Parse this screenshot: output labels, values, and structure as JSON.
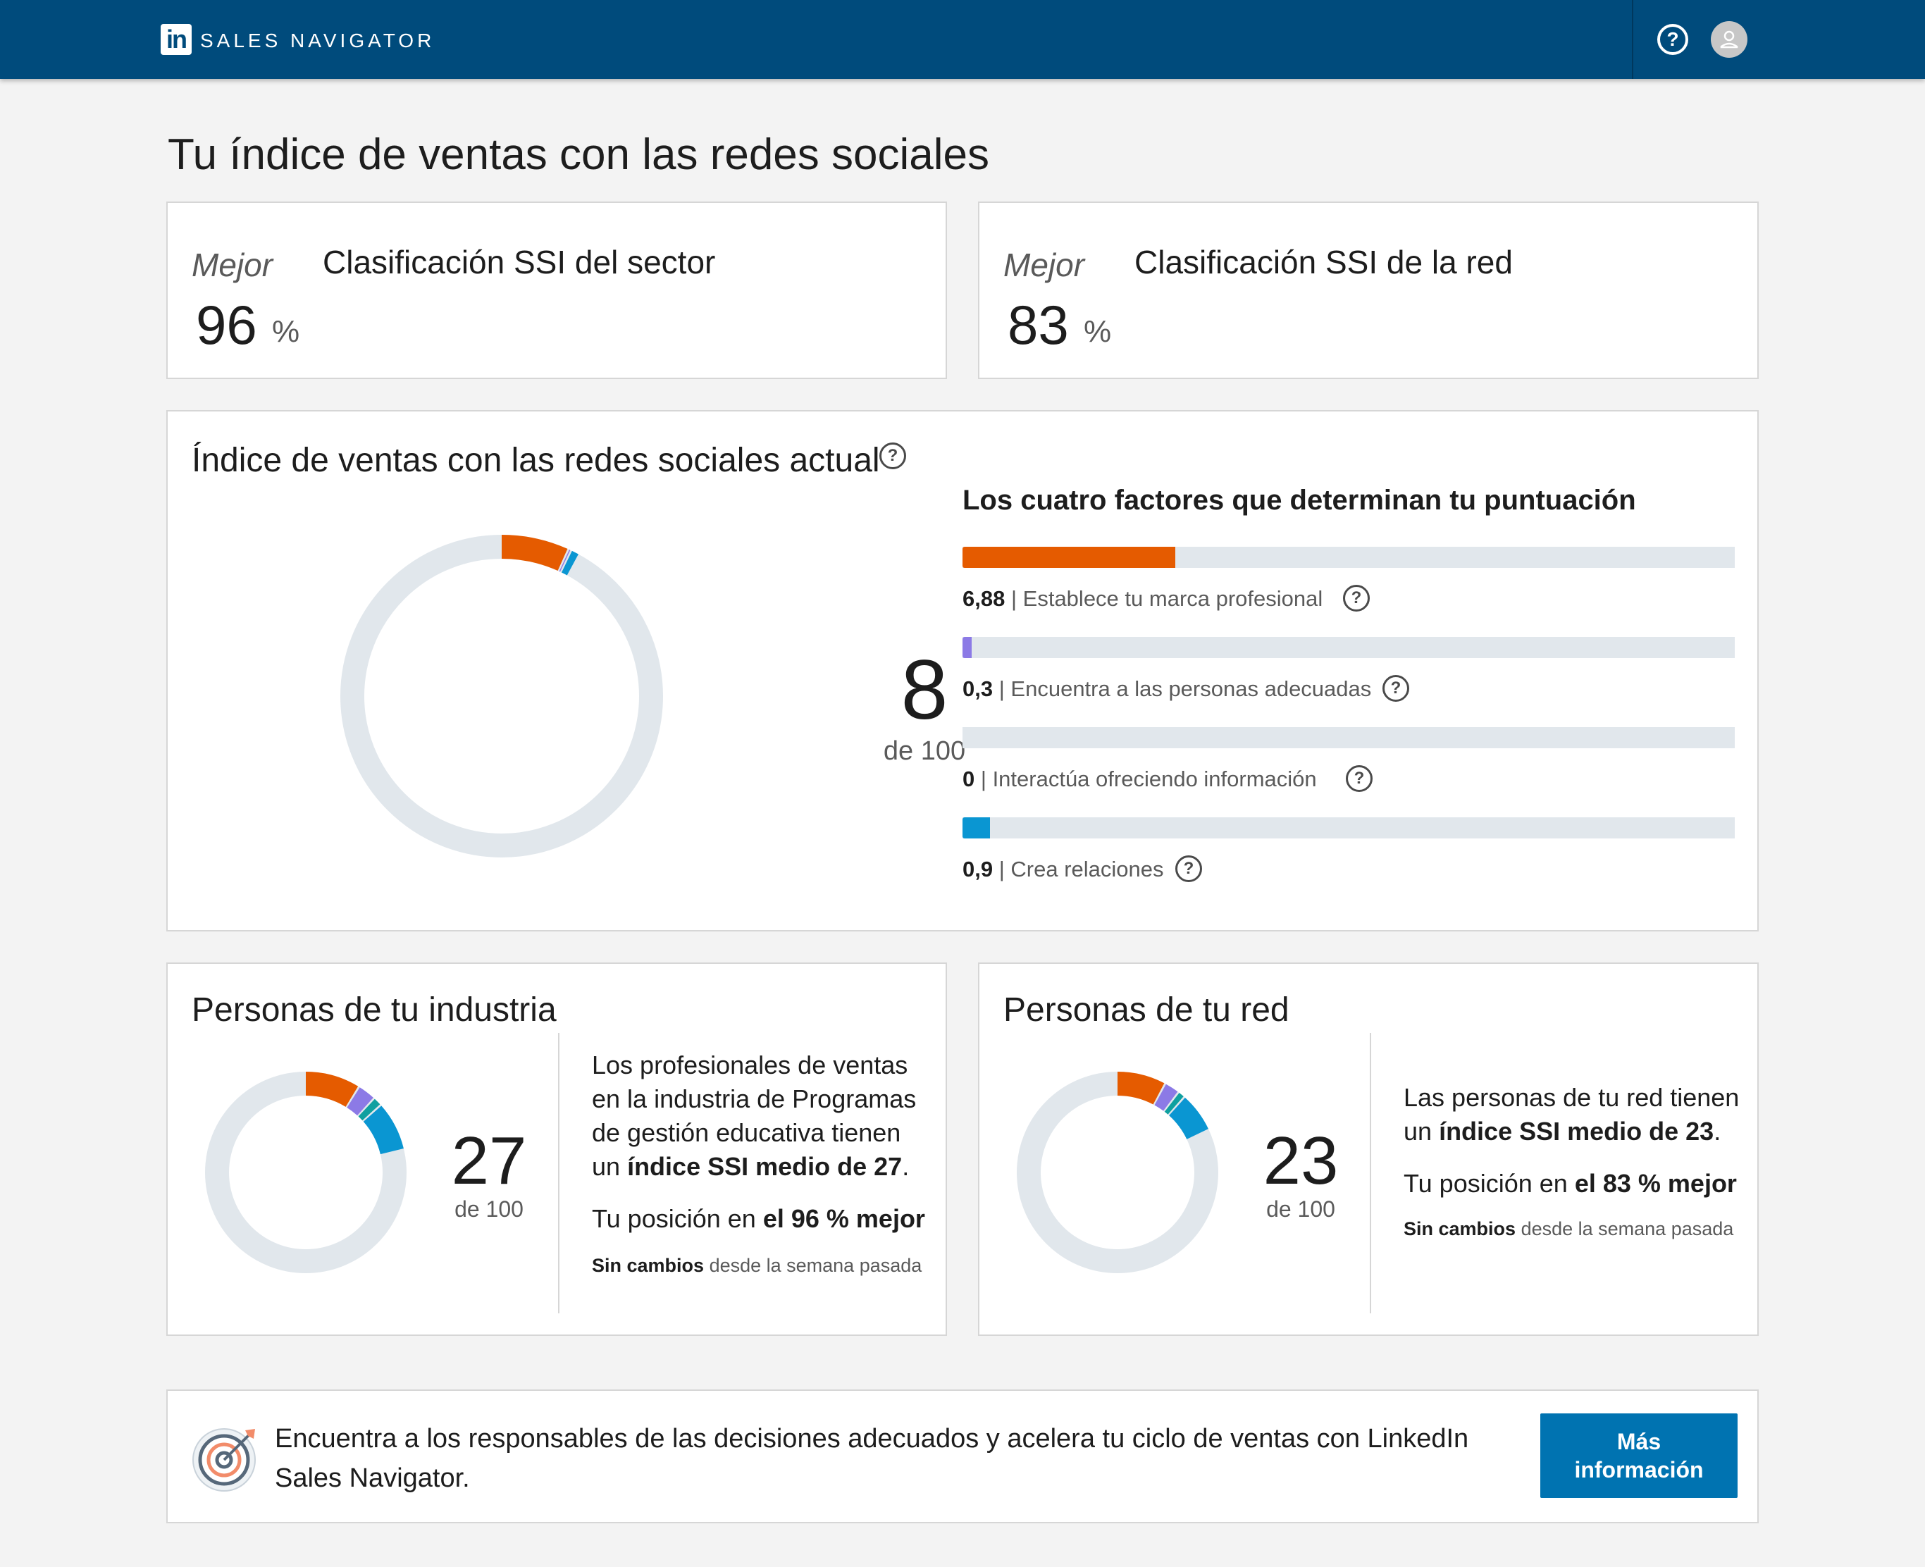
{
  "header": {
    "logo_text": "in",
    "brand": "SALES NAVIGATOR",
    "help_icon": "question-circle-icon",
    "avatar_icon": "user-avatar-icon",
    "bg_color": "#004b7c"
  },
  "page_title": "Tu índice de ventas con las redes sociales",
  "rankings": {
    "sector": {
      "mejor": "Mejor",
      "value": "96",
      "unit": "%",
      "title": "Clasificación SSI del sector"
    },
    "network": {
      "mejor": "Mejor",
      "value": "83",
      "unit": "%",
      "title": "Clasificación SSI de la red"
    }
  },
  "current": {
    "title": "Índice de ventas con las redes sociales actual",
    "score": "8",
    "of": "de 100",
    "factors_title": "Los cuatro factores que determinan tu puntuación",
    "max_per_factor": 25,
    "factors": [
      {
        "value": "6,88",
        "sep": "|",
        "label": "Establece tu marca profesional",
        "numeric": 6.88,
        "color": "#e55b00"
      },
      {
        "value": "0,3",
        "sep": "|",
        "label": "Encuentra a las personas adecuadas",
        "numeric": 0.3,
        "color": "#8c7ae6"
      },
      {
        "value": "0",
        "sep": "|",
        "label": "Interactúa ofreciendo información",
        "numeric": 0,
        "color": "#0fa0a0"
      },
      {
        "value": "0,9",
        "sep": "|",
        "label": "Crea relaciones",
        "numeric": 0.9,
        "color": "#0a96d2"
      }
    ]
  },
  "industry": {
    "title": "Personas de tu industria",
    "score": "27",
    "of": "de 100",
    "segments": [
      9,
      3,
      1.5,
      8
    ],
    "para_1": "Los profesionales de ventas en la industria de Programas de gestión educativa tienen un",
    "para_bold": "índice SSI medio de 27",
    "para_end": ".",
    "position_prefix": "Tu posición en",
    "position_bold": "el 96 % mejor",
    "since_bold": "Sin cambios",
    "since_rest": "desde la semana pasada"
  },
  "network": {
    "title": "Personas de tu red",
    "score": "23",
    "of": "de 100",
    "segments": [
      8,
      2.5,
      1.2,
      6.5
    ],
    "para_1": "Las personas de tu red tienen un",
    "para_bold": "índice SSI medio de 23",
    "para_end": ".",
    "position_prefix": "Tu posición en",
    "position_bold": "el 83 % mejor",
    "since_bold": "Sin cambios",
    "since_rest": "desde la semana pasada"
  },
  "promo": {
    "icon": "target-icon",
    "text": "Encuentra a los responsables de las decisiones adecuados y acelera tu ciclo de ventas con LinkedIn Sales Navigator.",
    "button_line1": "Más",
    "button_line2": "información"
  },
  "colors": {
    "brand_orange": "#e55b00",
    "brand_purple": "#8c7ae6",
    "brand_teal": "#0fa0a0",
    "brand_blue": "#0a96d2",
    "track": "#e1e7ec",
    "button": "#0073b1"
  }
}
